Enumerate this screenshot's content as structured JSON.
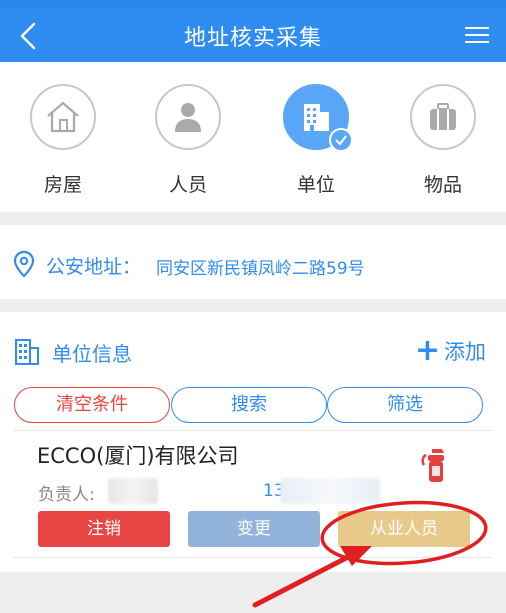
{
  "header": {
    "title": "地址核实采集"
  },
  "categories": [
    {
      "label": "房屋",
      "icon": "house-icon"
    },
    {
      "label": "人员",
      "icon": "person-icon"
    },
    {
      "label": "单位",
      "icon": "building-icon",
      "active": true
    },
    {
      "label": "物品",
      "icon": "luggage-icon"
    }
  ],
  "address": {
    "label": "公安地址：",
    "value": "同安区新民镇凤岭二路59号"
  },
  "unit_section": {
    "title": "单位信息",
    "add_label": "添加",
    "filters": {
      "clear": "清空条件",
      "search": "搜索",
      "filter": "筛选"
    }
  },
  "company": {
    "name": "ECCO(厦门)有限公司",
    "owner_label": "负责人:",
    "phone_prefix": "13",
    "actions": {
      "cancel": "注销",
      "change": "变更",
      "staff": "从业人员"
    }
  },
  "colors": {
    "primary": "#2f8cf0",
    "danger": "#e84545",
    "annotation": "#e02020"
  }
}
